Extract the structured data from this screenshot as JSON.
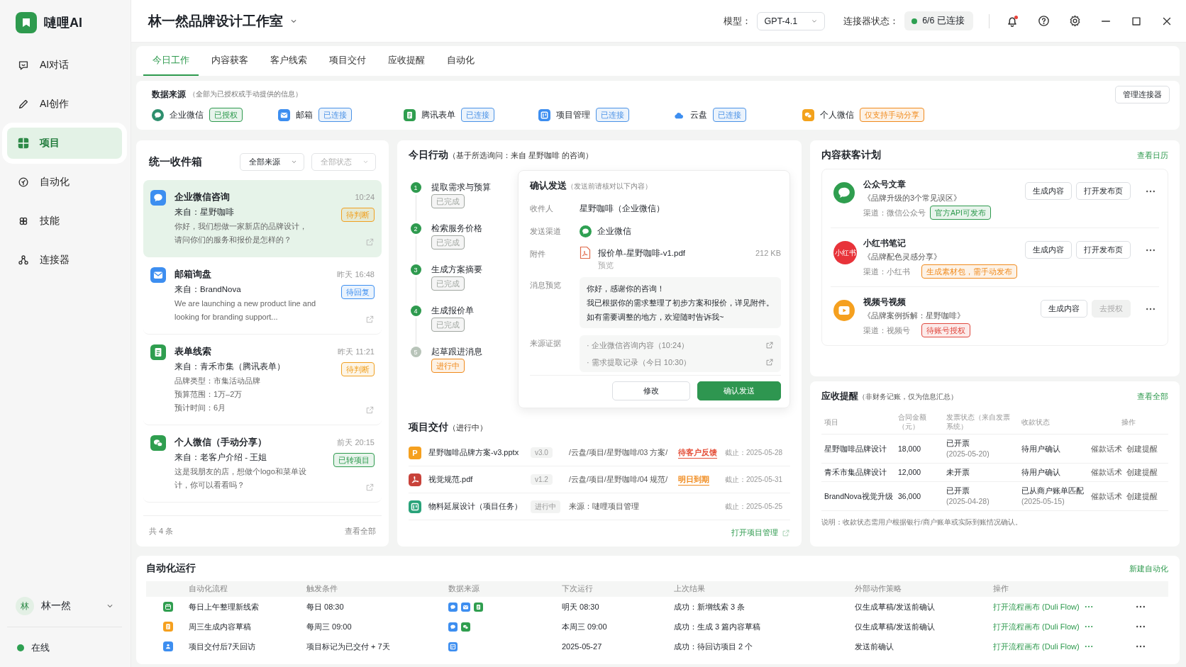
{
  "app": {
    "name": "嗹哩AI"
  },
  "sidebar": {
    "items": [
      {
        "label": "AI对话",
        "selected": false
      },
      {
        "label": "AI创作",
        "selected": false
      },
      {
        "label": "项目",
        "selected": true
      },
      {
        "label": "自动化",
        "selected": false
      },
      {
        "label": "技能",
        "selected": false
      },
      {
        "label": "连接器",
        "selected": false
      }
    ],
    "user": {
      "initial": "林",
      "name": "林一然"
    },
    "status": "在线"
  },
  "header": {
    "workspace": "林一然品牌设计工作室",
    "model_label": "模型：",
    "model": "GPT-4.1",
    "connector_label": "连接器状态：",
    "connector_status": "6/6 已连接",
    "unread": true
  },
  "tabs": [
    {
      "label": "今日工作",
      "selected": true
    },
    {
      "label": "内容获客",
      "selected": false
    },
    {
      "label": "客户线索",
      "selected": false
    },
    {
      "label": "项目交付",
      "selected": false
    },
    {
      "label": "应收提醒",
      "selected": false
    },
    {
      "label": "自动化",
      "selected": false
    }
  ],
  "data_sources": {
    "title": "数据来源",
    "note": "（全部为已授权或手动提供的信息）",
    "manage": "管理连接器",
    "items": [
      {
        "kind": "wecom",
        "name": "企业微信",
        "status": "已授权",
        "color": "#2e9a4e"
      },
      {
        "kind": "mail",
        "name": "邮箱",
        "status": "已连接",
        "color": "#4a92e6"
      },
      {
        "kind": "form",
        "name": "腾讯表单",
        "status": "已连接",
        "color": "#4a92e6"
      },
      {
        "kind": "project",
        "name": "项目管理",
        "status": "已连接",
        "color": "#4a92e6"
      },
      {
        "kind": "cloud",
        "name": "云盘",
        "status": "已连接",
        "color": "#4a92e6"
      },
      {
        "kind": "wechat",
        "name": "个人微信",
        "status": "仅支持手动分享",
        "color": "#f08a1c"
      }
    ]
  },
  "inbox": {
    "title": "统一收件箱",
    "filters": [
      {
        "label": "全部来源",
        "disabled": false
      },
      {
        "label": "全部状态",
        "disabled": true
      }
    ],
    "items": [
      {
        "kind": "wecom",
        "title": "企业微信咨询",
        "time": "10:24",
        "from": "来自：星野咖啡",
        "tag": "待判断",
        "color": "#f0a020",
        "body": [
          "你好，我们想做一家新店的品牌设计，",
          "请问你们的服务和报价是怎样的？"
        ],
        "selected": true
      },
      {
        "kind": "mail",
        "title": "邮箱询盘",
        "time": "昨天 16:48",
        "from": "来自：BrandNova",
        "tag": "待回复",
        "color": "#3d8ef0",
        "body": [
          "We are launching a new product line and",
          "looking for branding support..."
        ],
        "selected": false
      },
      {
        "kind": "form",
        "title": "表单线索",
        "time": "昨天 11:21",
        "from": "来自：青禾市集（腾讯表单）",
        "tag": "待判断",
        "color": "#f0a020",
        "body": [
          "品牌类型：市集活动品牌",
          "预算范围：1万–2万",
          "预计时间：6月"
        ],
        "selected": false
      },
      {
        "kind": "wechat",
        "title": "个人微信（手动分享）",
        "time": "前天 20:15",
        "from": "来自：老客户介绍 - 王姐",
        "tag": "已转项目",
        "color": "#2e9a4e",
        "body": [
          "这是我朋友的店，想做个logo和菜单设",
          "计，你可以看看吗？"
        ],
        "selected": false
      }
    ],
    "count": "共 4 条",
    "view_all": "查看全部"
  },
  "today": {
    "title": "今日行动",
    "context": "（基于所选询问：来自 星野咖啡 的咨询）",
    "steps": [
      {
        "no": "1",
        "label": "提取需求与预算",
        "status": "已完成",
        "done": true
      },
      {
        "no": "2",
        "label": "检索服务价格",
        "status": "已完成",
        "done": true
      },
      {
        "no": "3",
        "label": "生成方案摘要",
        "status": "已完成",
        "done": true
      },
      {
        "no": "4",
        "label": "生成报价单",
        "status": "已完成",
        "done": true
      },
      {
        "no": "5",
        "label": "起草跟进消息",
        "status": "进行中",
        "done": false
      }
    ],
    "confirm": {
      "title": "确认发送",
      "note": "（发送前请核对以下内容）",
      "recipient_label": "收件人",
      "recipient": "星野咖啡（企业微信）",
      "channel_label": "发送渠道",
      "channel": "企业微信",
      "attachment_label": "附件",
      "attachment": {
        "name": "报价单-星野咖啡-v1.pdf",
        "size": "212 KB",
        "preview": "预览"
      },
      "message_label": "消息预览",
      "message": [
        "你好，感谢你的咨询！",
        "我已根据你的需求整理了初步方案和报价，详见附件。",
        "如有需要调整的地方，欢迎随时告诉我~"
      ],
      "evidence_label": "来源证据",
      "evidence": [
        "· 企业微信咨询内容（10:24）",
        "· 需求提取记录（今日 10:30）"
      ],
      "buttons": [
        {
          "label": "修改",
          "primary": false
        },
        {
          "label": "确认发送",
          "primary": true
        }
      ]
    }
  },
  "delivery": {
    "title": "项目交付",
    "note": "（进行中）",
    "rows": [
      {
        "kind": "pptx",
        "badge": "P",
        "name": "星野咖啡品牌方案-v3.pptx",
        "version": "v3.0",
        "path": "/云盘/项目/星野咖啡/03 方案/",
        "status": "待客户反馈",
        "color": "#e5503a",
        "due": "截止：2025-05-28"
      },
      {
        "kind": "pdf",
        "name": "视觉规范.pdf",
        "version": "v1.2",
        "path": "/云盘/项目/星野咖啡/04 规范/",
        "status": "明日到期",
        "color": "#f08a1c",
        "due": "截止：2025-05-31"
      },
      {
        "kind": "task",
        "name": "物料延展设计（项目任务）",
        "version": "进行中",
        "path": "来源：嗹哩项目管理",
        "due": "截止：2025-05-25"
      }
    ],
    "link": "打开项目管理"
  },
  "content_plan": {
    "title": "内容获客计划",
    "link": "查看日历",
    "items": [
      {
        "kind": "article",
        "title": "公众号文章",
        "subject": "《品牌升级的3个常见误区》",
        "channel": "渠道：微信公众号",
        "tag": "官方API可发布",
        "color": "#2e9a4e",
        "actions": [
          {
            "label": "生成内容",
            "disabled": false
          },
          {
            "label": "打开发布页",
            "disabled": false
          }
        ]
      },
      {
        "kind": "note",
        "logo": "小红书",
        "title": "小红书笔记",
        "subject": "《品牌配色灵感分享》",
        "channel": "渠道：小红书",
        "tag": "生成素材包，需手动发布",
        "color": "#f08a1c",
        "actions": [
          {
            "label": "生成内容",
            "disabled": false
          },
          {
            "label": "打开发布页",
            "disabled": false
          }
        ]
      },
      {
        "kind": "video",
        "title": "视频号视频",
        "subject": "《品牌案例拆解：星野咖啡》",
        "channel": "渠道：视频号",
        "tag": "待账号授权",
        "color": "#e0483e",
        "actions": [
          {
            "label": "生成内容",
            "disabled": false
          },
          {
            "label": "去授权",
            "disabled": true
          }
        ]
      }
    ]
  },
  "receivables": {
    "title": "应收提醒",
    "note": "（非财务记账，仅为信息汇总）",
    "link": "查看全部",
    "columns": [
      "项目",
      "合同金额（元）",
      "发票状态（来自发票系统）",
      "收款状态",
      "操作"
    ],
    "rows": [
      {
        "project": "星野咖啡品牌设计",
        "amount": "18,000",
        "invoice": "已开票",
        "invoice_date": "(2025-05-20)",
        "payment": "待用户确认",
        "actions": [
          "催款话术",
          "创建提醒"
        ]
      },
      {
        "project": "青禾市集品牌设计",
        "amount": "12,000",
        "invoice": "未开票",
        "payment": "待用户确认",
        "actions": [
          "催款话术",
          "创建提醒"
        ]
      },
      {
        "project": "BrandNova视觉升级",
        "amount": "36,000",
        "invoice": "已开票",
        "invoice_date": "(2025-04-28)",
        "payment": "已从商户账单匹配",
        "payment_date": "(2025-05-15)",
        "actions": [
          "催款话术",
          "创建提醒"
        ]
      }
    ],
    "footnote": "说明：收款状态需用户根据银行/商户账单或实际到账情况确认。"
  },
  "automation": {
    "title": "自动化运行",
    "link": "新建自动化",
    "columns": [
      "自动化流程",
      "触发条件",
      "数据来源",
      "下次运行",
      "上次结果",
      "外部动作策略",
      "操作"
    ],
    "rows": [
      {
        "kind": "schedule",
        "name": "每日上午整理新线索",
        "trigger": "每日 08:30",
        "sources": [
          {
            "kind": "wecom"
          },
          {
            "kind": "mail"
          },
          {
            "kind": "form"
          }
        ],
        "next": "明天 08:30",
        "result": "成功：新增线索 3 条",
        "policy": "仅生成草稿/发送前确认",
        "action": "打开流程画布 (Duli Flow)"
      },
      {
        "kind": "content",
        "name": "周三生成内容草稿",
        "trigger": "每周三 09:00",
        "sources": [
          {
            "kind": "wecom"
          },
          {
            "kind": "wechat"
          }
        ],
        "next": "本周三 09:00",
        "result": "成功：生成 3 篇内容草稿",
        "policy": "仅生成草稿/发送前确认",
        "action": "打开流程画布 (Duli Flow)"
      },
      {
        "kind": "followup",
        "name": "项目交付后7天回访",
        "trigger": "项目标记为已交付 + 7天",
        "sources": [
          {
            "kind": "project"
          }
        ],
        "next": "2025-05-27",
        "result": "成功：待回访项目 2 个",
        "policy": "发送前确认",
        "action": "打开流程画布 (Duli Flow)"
      }
    ]
  }
}
